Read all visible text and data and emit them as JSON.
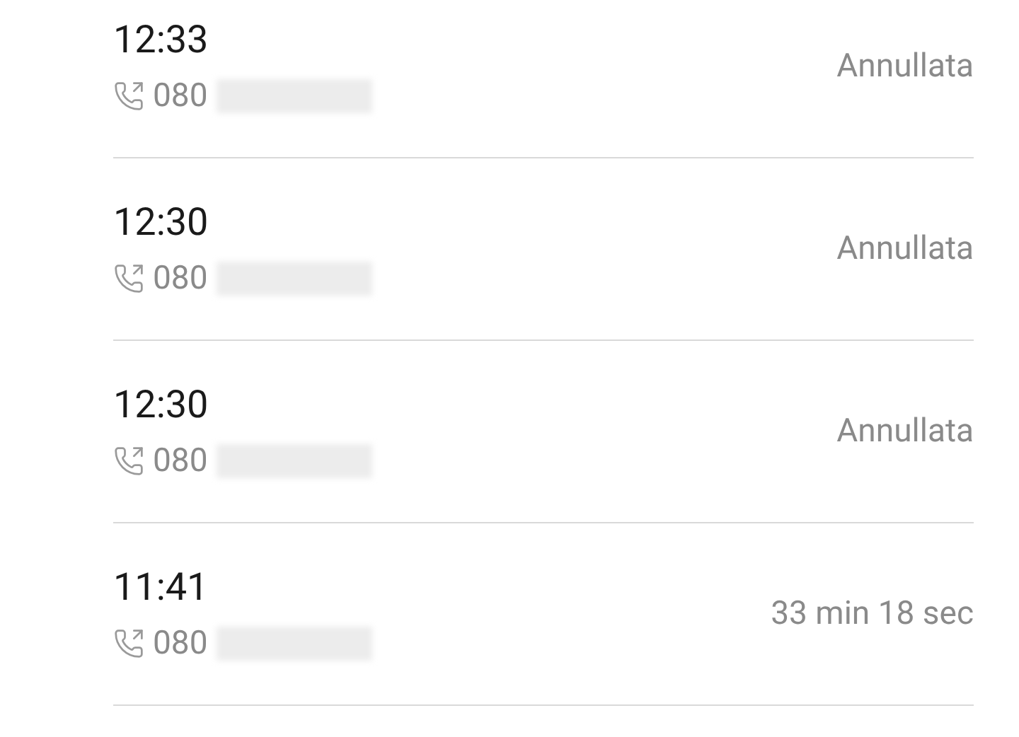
{
  "calls": [
    {
      "time": "12:33",
      "number": "080",
      "status": "Annullata"
    },
    {
      "time": "12:30",
      "number": "080",
      "status": "Annullata"
    },
    {
      "time": "12:30",
      "number": "080",
      "status": "Annullata"
    },
    {
      "time": "11:41",
      "number": "080",
      "status": "33 min 18 sec"
    }
  ]
}
